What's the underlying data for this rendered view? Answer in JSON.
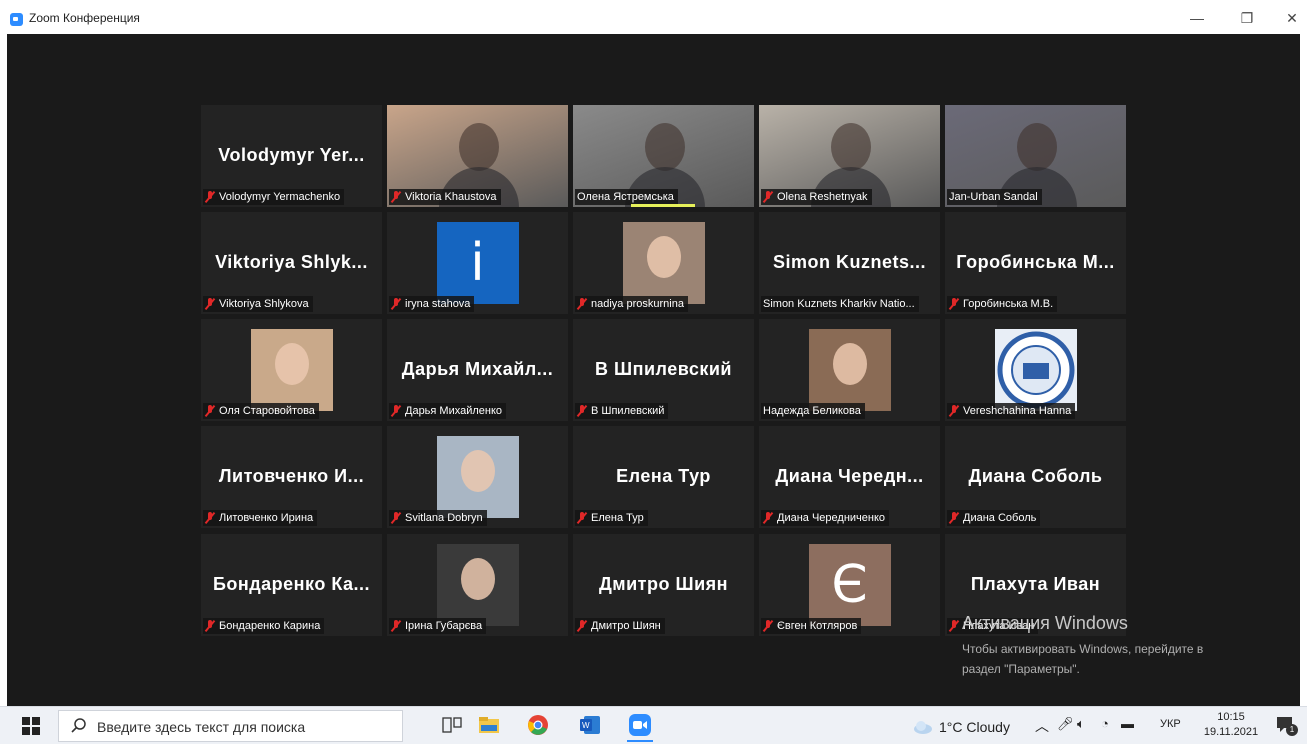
{
  "window": {
    "title": "Zoom Конференция"
  },
  "participants": [
    {
      "big_name": "Volodymyr Yer...",
      "label": "Volodymyr Yermachenko",
      "muted": true,
      "kind": "name"
    },
    {
      "big_name": "",
      "label": "Viktoria Khaustova",
      "muted": true,
      "kind": "video",
      "bg": "#c9a58a"
    },
    {
      "big_name": "",
      "label": "Олена Ястремська",
      "muted": false,
      "kind": "video",
      "bg": "#8a8a8a"
    },
    {
      "big_name": "",
      "label": "Olena Reshetnyak",
      "muted": true,
      "kind": "video",
      "bg": "#b9b2a8"
    },
    {
      "big_name": "",
      "label": "Jan-Urban Sandal",
      "muted": false,
      "kind": "video",
      "bg": "#6b6a78",
      "active": true
    },
    {
      "big_name": "Viktoriya Shlyk...",
      "label": "Viktoriya Shlykova",
      "muted": true,
      "kind": "name"
    },
    {
      "big_name": "",
      "label": "iryna stahova",
      "muted": true,
      "kind": "letter",
      "letter": "i",
      "avatar_color": "#1565c0"
    },
    {
      "big_name": "",
      "label": "nadiya proskurnina",
      "muted": true,
      "kind": "photo",
      "bg": "#9b8474"
    },
    {
      "big_name": "Simon Kuznets...",
      "label": "Simon Kuznets Kharkiv Natio...",
      "muted": false,
      "kind": "name"
    },
    {
      "big_name": "Горобинська М...",
      "label": "Горобинська М.В.",
      "muted": true,
      "kind": "name"
    },
    {
      "big_name": "",
      "label": "Оля Старовойтова",
      "muted": true,
      "kind": "photo",
      "bg": "#c9a98a"
    },
    {
      "big_name": "Дарья Михайл...",
      "label": "Дарья Михайленко",
      "muted": true,
      "kind": "name"
    },
    {
      "big_name": "В Шпилевский",
      "label": "В Шпилевский",
      "muted": true,
      "kind": "name"
    },
    {
      "big_name": "",
      "label": "Надежда Беликова",
      "muted": false,
      "kind": "photo",
      "bg": "#8a6b55"
    },
    {
      "big_name": "",
      "label": "Vereshchahina Hanna",
      "muted": true,
      "kind": "logo",
      "bg": "#e8eef6"
    },
    {
      "big_name": "Литовченко И...",
      "label": "Литовченко Ирина",
      "muted": true,
      "kind": "name"
    },
    {
      "big_name": "",
      "label": "Svitlana Dobryn",
      "muted": true,
      "kind": "photo",
      "bg": "#a9b6c4"
    },
    {
      "big_name": "Елена Тур",
      "label": "Елена Тур",
      "muted": true,
      "kind": "name"
    },
    {
      "big_name": "Диана Чередн...",
      "label": "Диана Чередниченко",
      "muted": true,
      "kind": "name"
    },
    {
      "big_name": "Диана Соболь",
      "label": "Диана Соболь",
      "muted": true,
      "kind": "name"
    },
    {
      "big_name": "Бондаренко Ка...",
      "label": "Бондаренко Карина",
      "muted": true,
      "kind": "name"
    },
    {
      "big_name": "",
      "label": "Ірина Губарєва",
      "muted": true,
      "kind": "photo",
      "bg": "#3a3a3a"
    },
    {
      "big_name": "Дмитро Шиян",
      "label": "Дмитро Шиян",
      "muted": true,
      "kind": "name"
    },
    {
      "big_name": "",
      "label": "Євген Котляров",
      "muted": true,
      "kind": "letter",
      "letter": "Є",
      "avatar_color": "#8d6e5f"
    },
    {
      "big_name": "Плахута Иван",
      "label": "Плахута Иван",
      "muted": true,
      "kind": "name"
    }
  ],
  "watermark": {
    "title": "Активация Windows",
    "line1": "Чтобы активировать Windows, перейдите в",
    "line2": "раздел \"Параметры\"."
  },
  "taskbar": {
    "search_placeholder": "Введите здесь текст для поиска",
    "weather": "1°C  Cloudy",
    "lang": "УКР",
    "time": "10:15",
    "date": "19.11.2021",
    "notif_count": "1"
  }
}
